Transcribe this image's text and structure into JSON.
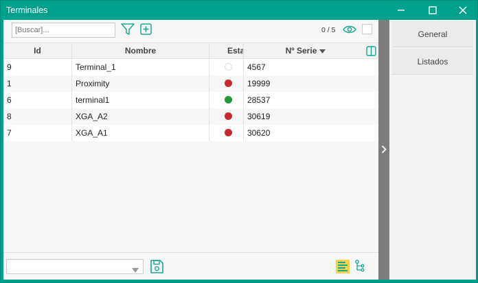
{
  "window": {
    "title": "Terminales"
  },
  "toolbar": {
    "search_placeholder": "[Buscar]...",
    "counter": "0 / 5"
  },
  "grid": {
    "columns": [
      "Id",
      "Nombre",
      "Esta",
      "Nº Serie"
    ],
    "rows": [
      {
        "id": "9",
        "nombre": "Terminal_1",
        "estado": "none",
        "serie": "4567"
      },
      {
        "id": "1",
        "nombre": "Proximity",
        "estado": "red",
        "serie": "19999"
      },
      {
        "id": "6",
        "nombre": "terminal1",
        "estado": "green",
        "serie": "28537"
      },
      {
        "id": "8",
        "nombre": "XGA_A2",
        "estado": "red",
        "serie": "30619"
      },
      {
        "id": "7",
        "nombre": "XGA_A1",
        "estado": "red",
        "serie": "30620"
      }
    ]
  },
  "sidebar": {
    "tabs": [
      "General",
      "Listados"
    ]
  },
  "colors": {
    "accent": "#00a08e",
    "status_red": "#c8282a",
    "status_green": "#1e9a3a"
  }
}
